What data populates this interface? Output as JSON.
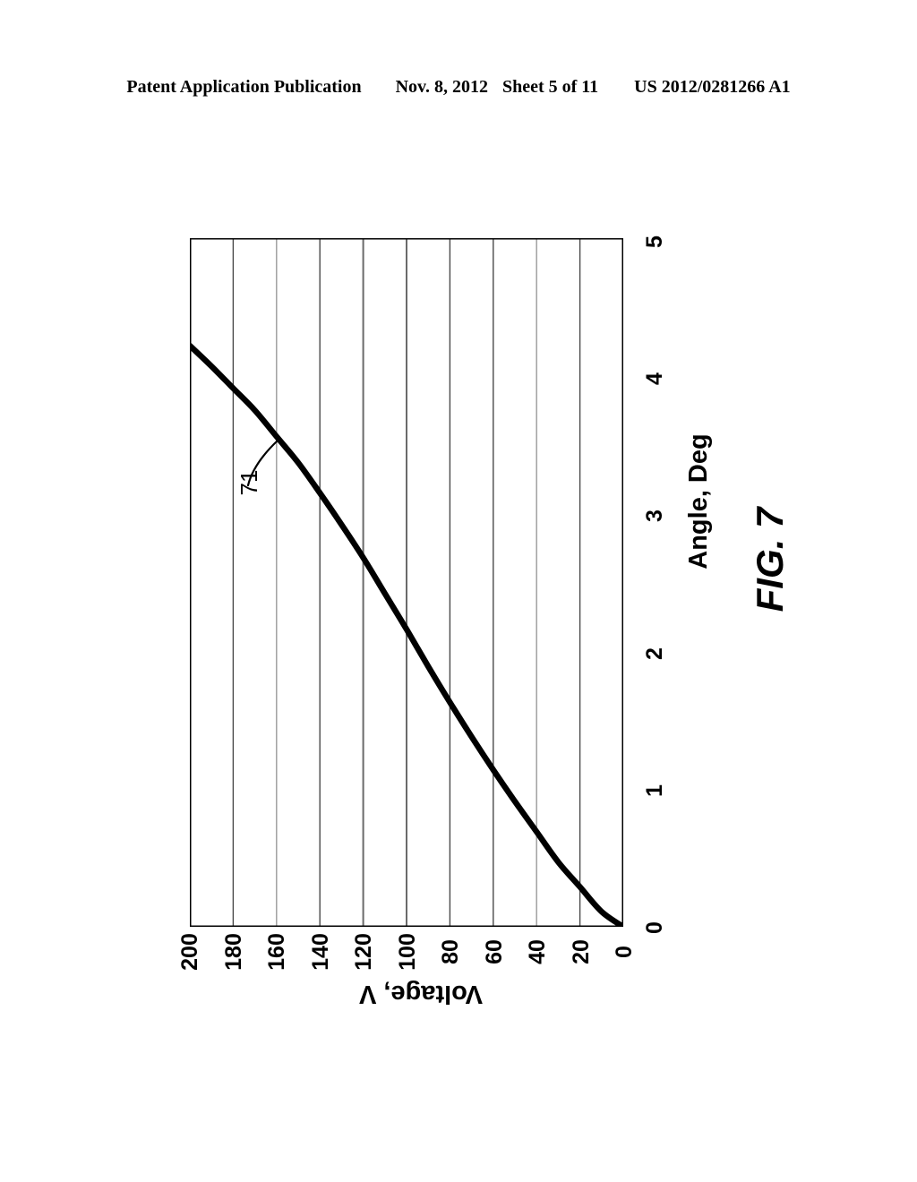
{
  "header": {
    "publication": "Patent Application Publication",
    "date": "Nov. 8, 2012",
    "sheet": "Sheet 5 of 11",
    "document_number": "US 2012/0281266 A1"
  },
  "figure": {
    "caption": "FIG. 7",
    "reference_numeral": "71"
  },
  "chart_data": {
    "type": "line",
    "title": "FIG. 7",
    "orientation": "rotated-90-clockwise",
    "xlabel": "Voltage, V",
    "ylabel": "Angle, Deg",
    "xlim": [
      0,
      200
    ],
    "ylim": [
      0,
      5
    ],
    "grid": true,
    "legend": null,
    "x_ticks": [
      0,
      20,
      40,
      60,
      80,
      100,
      120,
      140,
      160,
      180,
      200
    ],
    "x_tick_labels": [
      "0",
      "20",
      "40",
      "60",
      "80",
      "100",
      "120",
      "140",
      "160",
      "180",
      "200"
    ],
    "x_tick_labels_display_order": [
      "200",
      "180",
      "160",
      "140",
      "120",
      "100",
      "80",
      "60",
      "40",
      "20",
      "0"
    ],
    "y_ticks": [
      0,
      1,
      2,
      3,
      4,
      5
    ],
    "y_tick_labels": [
      "0",
      "1",
      "2",
      "3",
      "4",
      "5"
    ],
    "series": [
      {
        "name": "71",
        "label": "71",
        "color": "#000000",
        "x": [
          0,
          10,
          20,
          30,
          40,
          50,
          60,
          70,
          80,
          90,
          100,
          110,
          120,
          130,
          140,
          150,
          160,
          170,
          180,
          190,
          200
        ],
        "y": [
          0.0,
          0.11,
          0.29,
          0.47,
          0.69,
          0.91,
          1.14,
          1.38,
          1.63,
          1.89,
          2.16,
          2.42,
          2.68,
          2.92,
          3.15,
          3.37,
          3.56,
          3.75,
          3.91,
          4.07,
          4.22
        ]
      }
    ],
    "annotations": [
      {
        "text": "71",
        "x": 160,
        "y": 3.56,
        "type": "leader-line-callout"
      }
    ]
  }
}
